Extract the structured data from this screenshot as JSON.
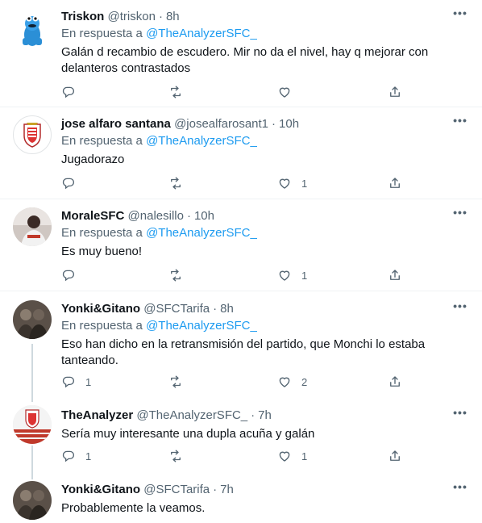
{
  "tweets": [
    {
      "name": "Triskon",
      "handle": "@triskon",
      "time": "8h",
      "reply_prefix": "En respuesta a",
      "reply_to": "@TheAnalyzerSFC_",
      "text": "Galán d recambio de escudero. Mir no da el nivel, hay q mejorar con delanteros contrastados",
      "replies": "",
      "retweets": "",
      "likes": ""
    },
    {
      "name": "jose alfaro santana",
      "handle": "@josealfarosant1",
      "time": "10h",
      "reply_prefix": "En respuesta a",
      "reply_to": "@TheAnalyzerSFC_",
      "text": "Jugadorazo",
      "replies": "",
      "retweets": "",
      "likes": "1"
    },
    {
      "name": "MoraleSFC",
      "handle": "@nalesillo",
      "time": "10h",
      "reply_prefix": "En respuesta a",
      "reply_to": "@TheAnalyzerSFC_",
      "text": "Es muy bueno!",
      "replies": "",
      "retweets": "",
      "likes": "1"
    },
    {
      "name": "Yonki&Gitano",
      "handle": "@SFCTarifa",
      "time": "8h",
      "reply_prefix": "En respuesta a",
      "reply_to": "@TheAnalyzerSFC_",
      "text": "Eso han dicho en la retransmisión del partido, que Monchi lo estaba tanteando.",
      "replies": "1",
      "retweets": "",
      "likes": "2"
    },
    {
      "name": "TheAnalyzer",
      "handle": "@TheAnalyzerSFC_",
      "time": "7h",
      "text": "Sería muy interesante una dupla acuña y galán",
      "replies": "1",
      "retweets": "",
      "likes": "1"
    },
    {
      "name": "Yonki&Gitano",
      "handle": "@SFCTarifa",
      "time": "7h",
      "text": "Probablemente la veamos."
    }
  ],
  "colors": {
    "link": "#1d9bf0",
    "secondary": "#536471",
    "divider": "#eff3f4",
    "thread_line": "#cfd9de"
  },
  "icons": {
    "reply": "reply-icon",
    "retweet": "retweet-icon",
    "like": "heart-icon",
    "share": "share-icon",
    "more": "more-icon"
  }
}
